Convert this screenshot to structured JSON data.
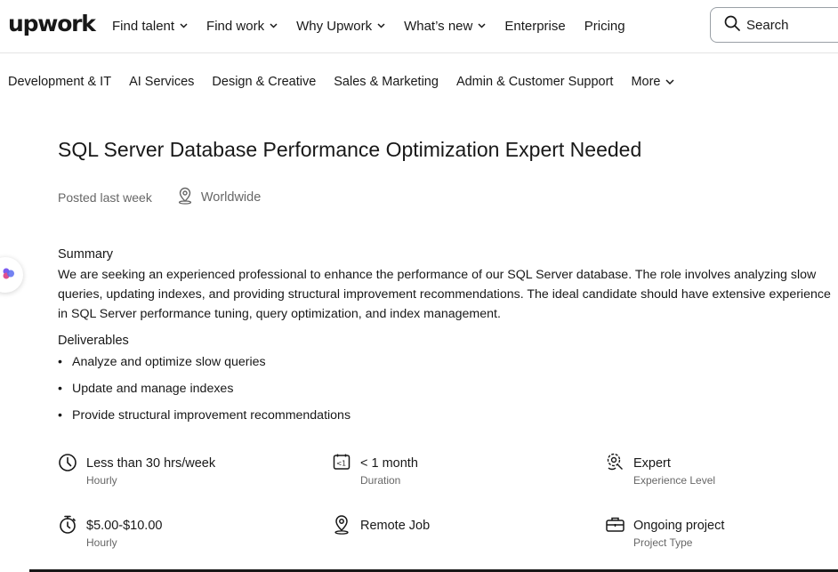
{
  "header": {
    "logo": "upwork",
    "nav": [
      {
        "label": "Find talent",
        "dropdown": true
      },
      {
        "label": "Find work",
        "dropdown": true
      },
      {
        "label": "Why Upwork",
        "dropdown": true
      },
      {
        "label": "What’s new",
        "dropdown": true
      },
      {
        "label": "Enterprise",
        "dropdown": false
      },
      {
        "label": "Pricing",
        "dropdown": false
      }
    ],
    "search": {
      "placeholder": "Search"
    }
  },
  "categories": [
    "Development & IT",
    "AI Services",
    "Design & Creative",
    "Sales & Marketing",
    "Admin & Customer Support",
    "More"
  ],
  "job": {
    "title": "SQL Server Database Performance Optimization Expert Needed",
    "posted": "Posted last week",
    "location": "Worldwide",
    "summary_label": "Summary",
    "summary": "We are seeking an experienced professional to enhance the performance of our SQL Server database. The role involves analyzing slow queries, updating indexes, and providing structural improvement recommendations. The ideal candidate should have extensive experience in SQL Server performance tuning, query optimization, and index management.",
    "deliverables_label": "Deliverables",
    "deliverables": [
      "Analyze and optimize slow queries",
      "Update and manage indexes",
      "Provide structural improvement recommendations"
    ]
  },
  "features": [
    {
      "icon": "clock-icon",
      "value": "Less than 30 hrs/week",
      "label": "Hourly"
    },
    {
      "icon": "calendar-duration-icon",
      "value": "< 1 month",
      "label": "Duration"
    },
    {
      "icon": "expertise-gear-icon",
      "value": "Expert",
      "label": "Experience Level"
    },
    {
      "icon": "stopwatch-icon",
      "value": "$5.00-$10.00",
      "label": "Hourly"
    },
    {
      "icon": "location-pin-icon",
      "value": "Remote Job",
      "label": ""
    },
    {
      "icon": "briefcase-icon",
      "value": "Ongoing project",
      "label": "Project Type"
    }
  ],
  "colors": {
    "text": "#181818",
    "muted": "#676767",
    "border": "#e4e4e4",
    "accent_badge": "#7b5cf0"
  }
}
